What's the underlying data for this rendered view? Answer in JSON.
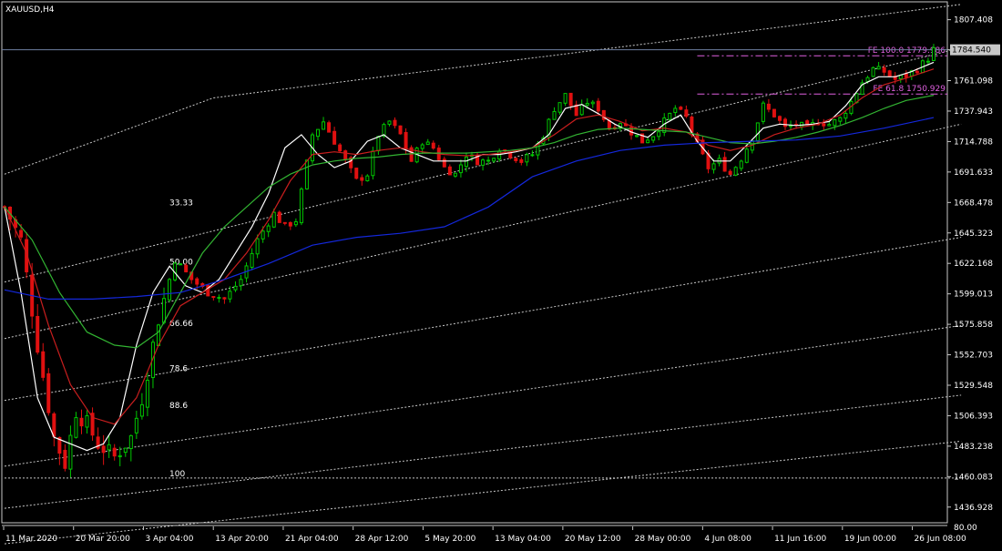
{
  "title": "XAUUSD,H4",
  "colors": {
    "background": "#000000",
    "frame": "#c8c8c8",
    "bull": "#00c800",
    "bear": "#e01010",
    "ma_fast": "#ffffff",
    "ma_mid": "#c81e1e",
    "ma_slow": "#32b432",
    "ma_long": "#1428dc",
    "fibo_channel": "#c8c8c8",
    "fibo_expansion": "#e060e0",
    "price_line": "#6e7fa0",
    "text": "#ffffff"
  },
  "chart_data": {
    "type": "candlestick",
    "symbol": "XAUUSD",
    "timeframe": "H4",
    "ylim": [
      1425.0,
      1821.0
    ],
    "y_ticks": [
      "1807.408",
      "1784.540",
      "1761.098",
      "1737.943",
      "1714.788",
      "1691.633",
      "1668.478",
      "1645.323",
      "1622.168",
      "1599.013",
      "1575.858",
      "1552.703",
      "1529.548",
      "1506.393",
      "1483.238",
      "1460.083",
      "1436.928"
    ],
    "current_price": "1784.540",
    "x_ticks": [
      "11 Mar 2020",
      "20 Mar 20:00",
      "3 Apr 04:00",
      "13 Apr 20:00",
      "21 Apr 04:00",
      "28 Apr 12:00",
      "5 May 20:00",
      "13 May 04:00",
      "20 May 12:00",
      "28 May 00:00",
      "4 Jun 08:00",
      "11 Jun 16:00",
      "19 Jun 00:00",
      "26 Jun 08:00"
    ],
    "indicator_label": "80.00",
    "price_path": [
      [
        0,
        1665
      ],
      [
        3,
        1640
      ],
      [
        6,
        1560
      ],
      [
        9,
        1490
      ],
      [
        11,
        1470
      ],
      [
        13,
        1510
      ],
      [
        15,
        1500
      ],
      [
        17,
        1485
      ],
      [
        20,
        1475
      ],
      [
        23,
        1490
      ],
      [
        25,
        1520
      ],
      [
        28,
        1580
      ],
      [
        31,
        1625
      ],
      [
        34,
        1610
      ],
      [
        37,
        1600
      ],
      [
        40,
        1595
      ],
      [
        43,
        1610
      ],
      [
        46,
        1640
      ],
      [
        49,
        1660
      ],
      [
        51,
        1650
      ],
      [
        53,
        1655
      ],
      [
        56,
        1720
      ],
      [
        58,
        1730
      ],
      [
        60,
        1715
      ],
      [
        62,
        1700
      ],
      [
        64,
        1685
      ],
      [
        66,
        1690
      ],
      [
        68,
        1720
      ],
      [
        70,
        1730
      ],
      [
        72,
        1720
      ],
      [
        74,
        1700
      ],
      [
        76,
        1715
      ],
      [
        78,
        1710
      ],
      [
        80,
        1695
      ],
      [
        82,
        1690
      ],
      [
        84,
        1705
      ],
      [
        86,
        1700
      ],
      [
        88,
        1700
      ],
      [
        90,
        1710
      ],
      [
        92,
        1705
      ],
      [
        94,
        1700
      ],
      [
        96,
        1705
      ],
      [
        98,
        1720
      ],
      [
        100,
        1740
      ],
      [
        102,
        1750
      ],
      [
        104,
        1735
      ],
      [
        106,
        1745
      ],
      [
        108,
        1740
      ],
      [
        110,
        1725
      ],
      [
        112,
        1730
      ],
      [
        114,
        1722
      ],
      [
        116,
        1715
      ],
      [
        118,
        1720
      ],
      [
        120,
        1730
      ],
      [
        122,
        1740
      ],
      [
        124,
        1733
      ],
      [
        126,
        1712
      ],
      [
        128,
        1695
      ],
      [
        130,
        1700
      ],
      [
        132,
        1690
      ],
      [
        134,
        1702
      ],
      [
        136,
        1718
      ],
      [
        138,
        1742
      ],
      [
        140,
        1735
      ],
      [
        142,
        1725
      ],
      [
        144,
        1728
      ],
      [
        146,
        1725
      ],
      [
        148,
        1730
      ],
      [
        150,
        1728
      ],
      [
        152,
        1732
      ],
      [
        154,
        1745
      ],
      [
        156,
        1760
      ],
      [
        158,
        1770
      ],
      [
        160,
        1768
      ],
      [
        162,
        1762
      ],
      [
        164,
        1765
      ],
      [
        166,
        1770
      ],
      [
        168,
        1778
      ],
      [
        169,
        1784.5
      ]
    ],
    "moving_averages": [
      {
        "color_key": "ma_fast",
        "points": [
          [
            0,
            1665
          ],
          [
            3,
            1600
          ],
          [
            6,
            1520
          ],
          [
            9,
            1490
          ],
          [
            12,
            1485
          ],
          [
            15,
            1480
          ],
          [
            18,
            1485
          ],
          [
            21,
            1505
          ],
          [
            24,
            1560
          ],
          [
            27,
            1600
          ],
          [
            30,
            1620
          ],
          [
            33,
            1605
          ],
          [
            36,
            1600
          ],
          [
            39,
            1610
          ],
          [
            42,
            1630
          ],
          [
            45,
            1650
          ],
          [
            48,
            1675
          ],
          [
            51,
            1710
          ],
          [
            54,
            1720
          ],
          [
            57,
            1705
          ],
          [
            60,
            1695
          ],
          [
            63,
            1700
          ],
          [
            66,
            1715
          ],
          [
            69,
            1720
          ],
          [
            72,
            1710
          ],
          [
            75,
            1705
          ],
          [
            78,
            1700
          ],
          [
            81,
            1700
          ],
          [
            84,
            1700
          ],
          [
            87,
            1705
          ],
          [
            90,
            1705
          ],
          [
            93,
            1707
          ],
          [
            96,
            1710
          ],
          [
            99,
            1720
          ],
          [
            102,
            1740
          ],
          [
            105,
            1743
          ],
          [
            108,
            1736
          ],
          [
            111,
            1728
          ],
          [
            114,
            1722
          ],
          [
            117,
            1718
          ],
          [
            120,
            1728
          ],
          [
            123,
            1735
          ],
          [
            126,
            1715
          ],
          [
            129,
            1700
          ],
          [
            132,
            1700
          ],
          [
            135,
            1712
          ],
          [
            138,
            1725
          ],
          [
            141,
            1728
          ],
          [
            144,
            1727
          ],
          [
            147,
            1728
          ],
          [
            150,
            1730
          ],
          [
            153,
            1742
          ],
          [
            156,
            1758
          ],
          [
            159,
            1764
          ],
          [
            162,
            1764
          ],
          [
            165,
            1768
          ],
          [
            169,
            1775
          ]
        ]
      },
      {
        "color_key": "ma_mid",
        "points": [
          [
            0,
            1665
          ],
          [
            4,
            1630
          ],
          [
            8,
            1575
          ],
          [
            12,
            1530
          ],
          [
            16,
            1505
          ],
          [
            20,
            1500
          ],
          [
            24,
            1520
          ],
          [
            28,
            1560
          ],
          [
            32,
            1590
          ],
          [
            36,
            1600
          ],
          [
            40,
            1610
          ],
          [
            44,
            1630
          ],
          [
            48,
            1655
          ],
          [
            52,
            1685
          ],
          [
            56,
            1705
          ],
          [
            60,
            1707
          ],
          [
            64,
            1705
          ],
          [
            68,
            1708
          ],
          [
            72,
            1710
          ],
          [
            76,
            1707
          ],
          [
            80,
            1705
          ],
          [
            84,
            1704
          ],
          [
            88,
            1705
          ],
          [
            92,
            1707
          ],
          [
            96,
            1710
          ],
          [
            100,
            1720
          ],
          [
            104,
            1732
          ],
          [
            108,
            1735
          ],
          [
            112,
            1730
          ],
          [
            116,
            1723
          ],
          [
            120,
            1725
          ],
          [
            124,
            1722
          ],
          [
            128,
            1712
          ],
          [
            132,
            1708
          ],
          [
            136,
            1712
          ],
          [
            140,
            1720
          ],
          [
            144,
            1725
          ],
          [
            148,
            1728
          ],
          [
            152,
            1735
          ],
          [
            156,
            1748
          ],
          [
            160,
            1758
          ],
          [
            164,
            1763
          ],
          [
            169,
            1770
          ]
        ]
      },
      {
        "color_key": "ma_slow",
        "points": [
          [
            0,
            1665
          ],
          [
            5,
            1640
          ],
          [
            10,
            1600
          ],
          [
            15,
            1570
          ],
          [
            20,
            1560
          ],
          [
            24,
            1558
          ],
          [
            28,
            1570
          ],
          [
            32,
            1600
          ],
          [
            36,
            1630
          ],
          [
            40,
            1650
          ],
          [
            44,
            1665
          ],
          [
            48,
            1680
          ],
          [
            52,
            1690
          ],
          [
            56,
            1697
          ],
          [
            60,
            1700
          ],
          [
            64,
            1702
          ],
          [
            68,
            1703
          ],
          [
            72,
            1705
          ],
          [
            76,
            1706
          ],
          [
            80,
            1706
          ],
          [
            84,
            1706
          ],
          [
            88,
            1707
          ],
          [
            92,
            1708
          ],
          [
            96,
            1710
          ],
          [
            100,
            1714
          ],
          [
            104,
            1720
          ],
          [
            108,
            1724
          ],
          [
            112,
            1725
          ],
          [
            116,
            1724
          ],
          [
            120,
            1723
          ],
          [
            124,
            1722
          ],
          [
            128,
            1718
          ],
          [
            132,
            1714
          ],
          [
            136,
            1713
          ],
          [
            140,
            1715
          ],
          [
            144,
            1718
          ],
          [
            148,
            1722
          ],
          [
            152,
            1727
          ],
          [
            156,
            1733
          ],
          [
            160,
            1740
          ],
          [
            164,
            1746
          ],
          [
            169,
            1750
          ]
        ]
      },
      {
        "color_key": "ma_long",
        "points": [
          [
            0,
            1602
          ],
          [
            8,
            1595
          ],
          [
            16,
            1595
          ],
          [
            24,
            1597
          ],
          [
            32,
            1600
          ],
          [
            40,
            1610
          ],
          [
            48,
            1622
          ],
          [
            56,
            1636
          ],
          [
            64,
            1642
          ],
          [
            72,
            1645
          ],
          [
            80,
            1650
          ],
          [
            88,
            1665
          ],
          [
            96,
            1688
          ],
          [
            104,
            1700
          ],
          [
            112,
            1708
          ],
          [
            120,
            1712
          ],
          [
            128,
            1714
          ],
          [
            136,
            1715
          ],
          [
            144,
            1716
          ],
          [
            152,
            1719
          ],
          [
            160,
            1725
          ],
          [
            169,
            1733
          ]
        ]
      }
    ],
    "fibo_levels": [
      {
        "label": "33.33",
        "value": 1665
      },
      {
        "label": "50.00",
        "value": 1620
      },
      {
        "label": "66.66",
        "value": 1573
      },
      {
        "label": "78.6",
        "value": 1539
      },
      {
        "label": "88.6",
        "value": 1511
      },
      {
        "label": "100",
        "value": 1459
      }
    ],
    "fibo_channel_lines": [
      {
        "x0": 0,
        "v0": 1690,
        "x1": 38,
        "v1": 1748
      },
      {
        "x0": 38,
        "v0": 1748,
        "x1": 174,
        "v1": 1819
      },
      {
        "x0": 0,
        "v0": 1608,
        "x1": 174,
        "v1": 1786
      },
      {
        "x0": 0,
        "v0": 1565,
        "x1": 174,
        "v1": 1728
      },
      {
        "x0": 0,
        "v0": 1518,
        "x1": 174,
        "v1": 1642
      },
      {
        "x0": 0,
        "v0": 1468,
        "x1": 174,
        "v1": 1575
      },
      {
        "x0": 0,
        "v0": 1436,
        "x1": 174,
        "v1": 1522
      },
      {
        "x0": 0,
        "v0": 1409,
        "x1": 174,
        "v1": 1487
      },
      {
        "x0": 0,
        "v0": 1459,
        "x1": 174,
        "v1": 1459
      }
    ],
    "fibo_expansion": [
      {
        "label": "FE 100.0  1779.986",
        "value": 1779.986
      },
      {
        "label": "FE 61.8   1750.929",
        "value": 1750.929
      }
    ]
  }
}
